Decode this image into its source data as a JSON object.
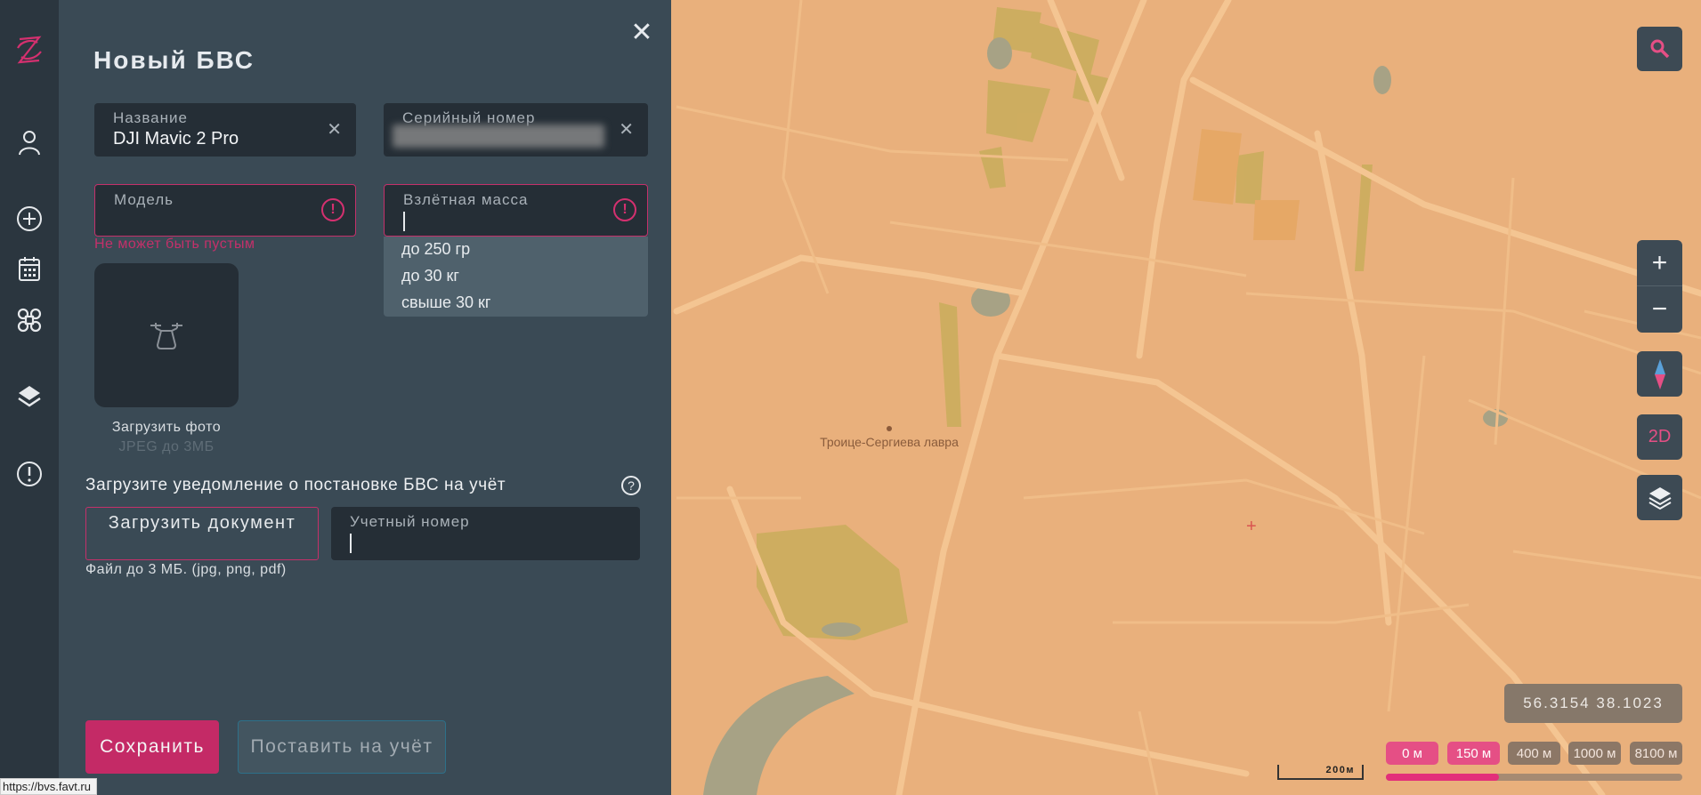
{
  "sidebar": {
    "items": [
      "logo",
      "profile",
      "add",
      "calendar",
      "drones",
      "layers",
      "alerts"
    ]
  },
  "panel": {
    "title": "Новый БВС",
    "name_field": {
      "label": "Название",
      "value": "DJI Mavic 2 Pro"
    },
    "serial_field": {
      "label": "Серийный номер",
      "value": ""
    },
    "model_field": {
      "label": "Модель",
      "value": "",
      "error": "Не может быть пустым"
    },
    "mass_field": {
      "label": "Взлётная масса",
      "value": "",
      "options": [
        "до 250 гр",
        "до 30 кг",
        "свыше 30 кг"
      ]
    },
    "photo": {
      "label": "Загрузить фото",
      "hint": "JPEG до 3МБ"
    },
    "registration": {
      "heading": "Загрузите уведомление о постановке БВС на учёт",
      "upload_button": "Загрузить документ",
      "upload_hint": "Файл до 3 МБ. (jpg, png, pdf)",
      "account_field": {
        "label": "Учетный номер",
        "value": ""
      }
    },
    "save_button": "Сохранить",
    "register_button": "Поставить на учёт"
  },
  "map": {
    "label": "Троице-Сергиева лавра",
    "coordinates": "56.3154 38.1023",
    "view_mode": "2D",
    "scale": "200м",
    "altitudes": [
      "0 м",
      "150 м",
      "400 м",
      "1000 м",
      "8100 м"
    ],
    "altitude_selected_fraction": 0.38,
    "colors": {
      "accent": "#e54f85",
      "map_bg": "#e9b07c"
    }
  },
  "status_url": "https://bvs.favt.ru"
}
